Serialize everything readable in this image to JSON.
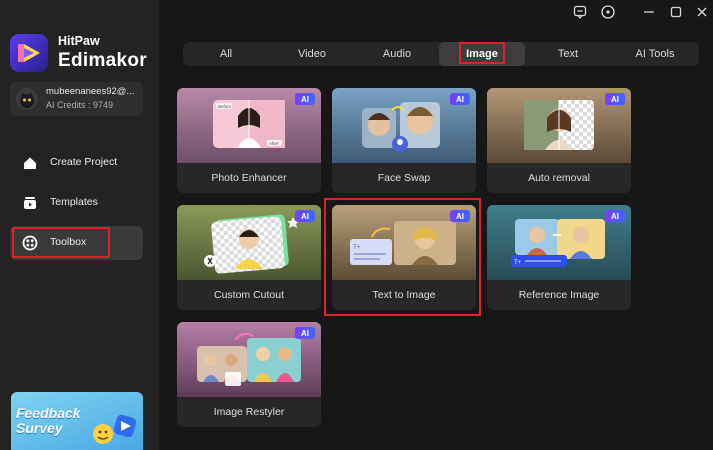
{
  "brand": {
    "small": "HitPaw",
    "big": "Edimakor"
  },
  "user": {
    "name": "mubeenanees92@...",
    "credits": "AI Credits : 9749"
  },
  "nav": [
    {
      "label": "Create Project",
      "icon": "house-icon"
    },
    {
      "label": "Templates",
      "icon": "templates-icon"
    },
    {
      "label": "Toolbox",
      "icon": "toolbox-icon",
      "active": true
    }
  ],
  "feedback": {
    "line1": "Feedback",
    "line2": "Survey"
  },
  "tabs": [
    "All",
    "Video",
    "Audio",
    "Image",
    "Text",
    "AI Tools"
  ],
  "active_tab": "Image",
  "ai_badge": "AI",
  "tools": [
    {
      "label": "Photo Enhancer",
      "ai": true
    },
    {
      "label": "Face Swap",
      "ai": true
    },
    {
      "label": "Auto removal",
      "ai": true
    },
    {
      "label": "Custom Cutout",
      "ai": true
    },
    {
      "label": "Text to Image",
      "ai": true
    },
    {
      "label": "Reference Image",
      "ai": true
    },
    {
      "label": "Image Restyler",
      "ai": true
    }
  ],
  "enhancer_thumb": {
    "before": "Before",
    "after": "After"
  },
  "colors": {
    "highlight": "#d8232a",
    "ai_badge_start": "#7a3cff",
    "ai_badge_end": "#3c68ff",
    "sidebar_bg": "#232323",
    "main_bg": "#171717"
  }
}
